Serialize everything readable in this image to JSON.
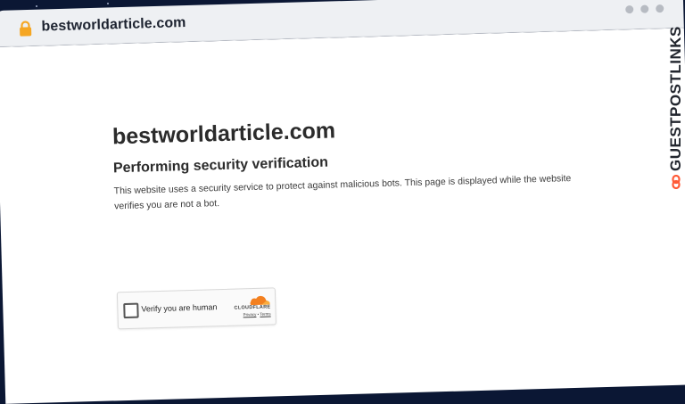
{
  "browser": {
    "url": "bestworldarticle.com",
    "icons": {
      "lock": "lock-icon",
      "window_dots": "window-dots"
    },
    "colors": {
      "lock": "#f5a623",
      "chrome": "#eef0f3"
    }
  },
  "page": {
    "site_title": "bestworldarticle.com",
    "heading": "Performing security verification",
    "description": "This website uses a security service to protect against malicious bots. This page is displayed while the website verifies you are not a bot."
  },
  "widget": {
    "checkbox_label": "Verify you are human",
    "brand": "CLOUDFLARE",
    "privacy": "Privacy",
    "separator": "•",
    "terms": "Terms",
    "colors": {
      "cloud": "#f38020"
    }
  },
  "watermark": {
    "text": "GUESTPOSTLINKS",
    "icon": "link-icon",
    "colors": {
      "icon": "#ff5a36",
      "text": "#22262e"
    }
  }
}
